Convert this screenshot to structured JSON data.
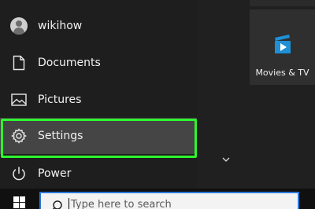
{
  "start_menu": {
    "items": [
      {
        "label": "wikihow",
        "icon": "user-avatar-icon"
      },
      {
        "label": "Documents",
        "icon": "document-icon"
      },
      {
        "label": "Pictures",
        "icon": "pictures-icon"
      },
      {
        "label": "Settings",
        "icon": "gear-icon"
      },
      {
        "label": "Power",
        "icon": "power-icon"
      }
    ]
  },
  "tiles": {
    "movies_tv": {
      "label": "Movies & TV",
      "icon": "movies-tv-icon"
    }
  },
  "taskbar": {
    "search_placeholder": "Type here to search",
    "start_icon": "windows-logo-icon"
  },
  "colors": {
    "highlight": "#2ef52e",
    "selected_item_bg": "#454545",
    "accent": "#1e90d6"
  }
}
